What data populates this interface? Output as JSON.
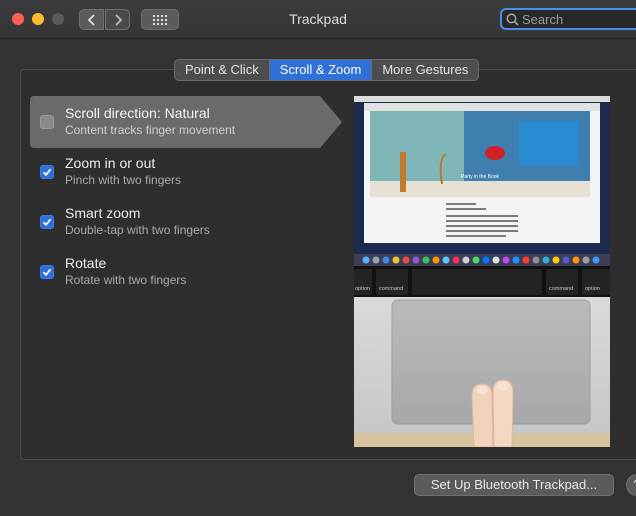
{
  "window": {
    "title": "Trackpad"
  },
  "search": {
    "placeholder": "Search"
  },
  "tabs": [
    {
      "label": "Point & Click",
      "active": false
    },
    {
      "label": "Scroll & Zoom",
      "active": true
    },
    {
      "label": "More Gestures",
      "active": false
    }
  ],
  "options": [
    {
      "title": "Scroll direction: Natural",
      "subtitle": "Content tracks finger movement",
      "checked": false,
      "selected": true
    },
    {
      "title": "Zoom in or out",
      "subtitle": "Pinch with two fingers",
      "checked": true,
      "selected": false
    },
    {
      "title": "Smart zoom",
      "subtitle": "Double-tap with two fingers",
      "checked": true,
      "selected": false
    },
    {
      "title": "Rotate",
      "subtitle": "Rotate with two fingers",
      "checked": true,
      "selected": false
    }
  ],
  "preview": {
    "banner_title": "Party in the Book",
    "keys": [
      "option",
      "command",
      "command",
      "option"
    ]
  },
  "footer": {
    "setup_button": "Set Up Bluetooth Trackpad...",
    "help_button": "?"
  },
  "colors": {
    "accent": "#2f6fd8",
    "window_bg": "#323232"
  }
}
